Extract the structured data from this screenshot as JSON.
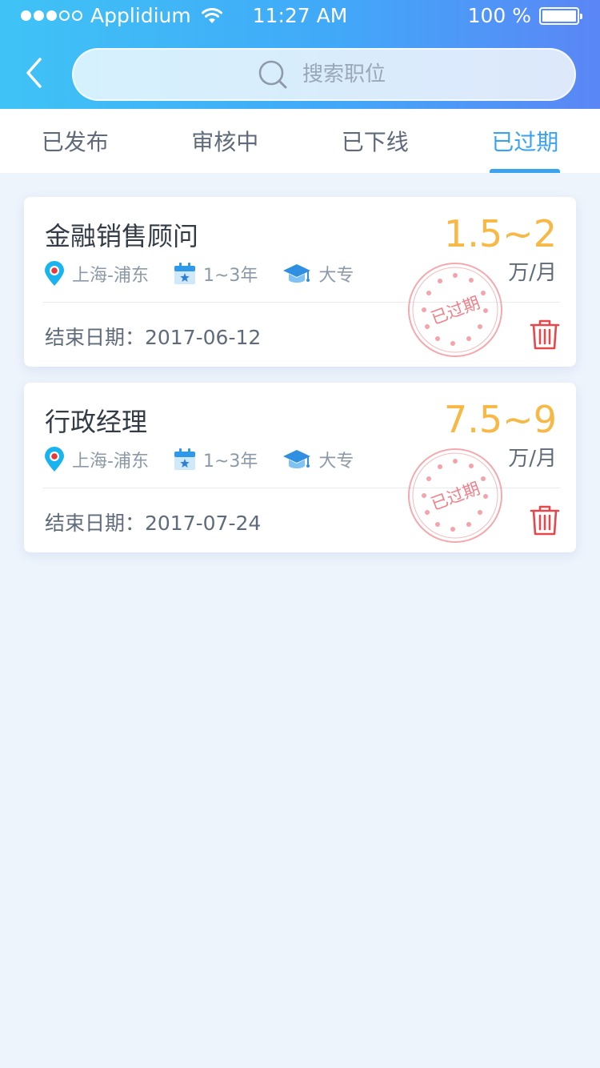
{
  "status_bar": {
    "carrier": "Applidium",
    "time": "11:27 AM",
    "battery": "100 %"
  },
  "search": {
    "placeholder": "搜索职位"
  },
  "tabs": [
    {
      "label": "已发布",
      "active": false
    },
    {
      "label": "审核中",
      "active": false
    },
    {
      "label": "已下线",
      "active": false
    },
    {
      "label": "已过期",
      "active": true
    }
  ],
  "jobs": [
    {
      "title": "金融销售顾问",
      "salary": "1.5~2",
      "salary_unit": "万/月",
      "location": "上海-浦东",
      "experience": "1~3年",
      "education": "大专",
      "end_date": "结束日期：2017-06-12",
      "stamp": "已过期"
    },
    {
      "title": "行政经理",
      "salary": "7.5~9",
      "salary_unit": "万/月",
      "location": "上海-浦东",
      "experience": "1~3年",
      "education": "大专",
      "end_date": "结束日期：2017-07-24",
      "stamp": "已过期"
    }
  ],
  "colors": {
    "accent": "#3aa3f0",
    "salary": "#f7b845",
    "delete": "#e5474d",
    "stamp": "#f07f88"
  }
}
